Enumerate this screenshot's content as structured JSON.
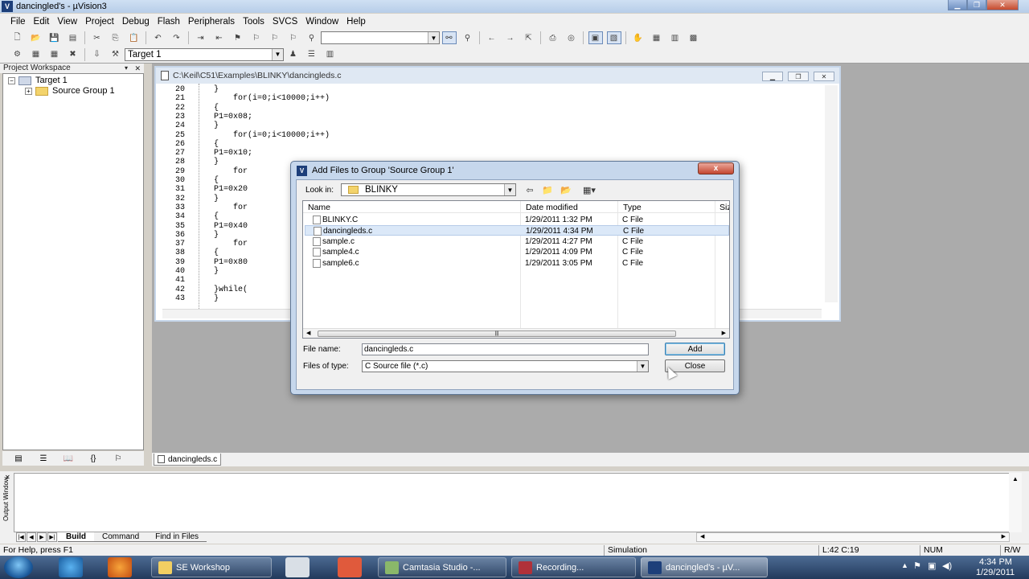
{
  "window": {
    "title": "dancingled's - µVision3"
  },
  "menu": [
    "File",
    "Edit",
    "View",
    "Project",
    "Debug",
    "Flash",
    "Peripherals",
    "Tools",
    "SVCS",
    "Window",
    "Help"
  ],
  "toolbar2": {
    "target_select": "Target 1"
  },
  "workspace": {
    "header": "Project Workspace",
    "tree": {
      "target": "Target 1",
      "group": "Source Group 1"
    }
  },
  "editor": {
    "path": "C:\\Keil\\C51\\Examples\\BLINKY\\dancingleds.c",
    "tab": "dancingleds.c",
    "lines": [
      {
        "n": "20",
        "t": "}"
      },
      {
        "n": "21",
        "t": "    for(i=0;i<10000;i++)"
      },
      {
        "n": "22",
        "t": "{"
      },
      {
        "n": "23",
        "t": "P1=0x08;"
      },
      {
        "n": "24",
        "t": "}"
      },
      {
        "n": "25",
        "t": "    for(i=0;i<10000;i++)"
      },
      {
        "n": "26",
        "t": "{"
      },
      {
        "n": "27",
        "t": "P1=0x10;"
      },
      {
        "n": "28",
        "t": "}"
      },
      {
        "n": "29",
        "t": "    for"
      },
      {
        "n": "30",
        "t": "{"
      },
      {
        "n": "31",
        "t": "P1=0x20"
      },
      {
        "n": "32",
        "t": "}"
      },
      {
        "n": "33",
        "t": "    for"
      },
      {
        "n": "34",
        "t": "{"
      },
      {
        "n": "35",
        "t": "P1=0x40"
      },
      {
        "n": "36",
        "t": "}"
      },
      {
        "n": "37",
        "t": "    for"
      },
      {
        "n": "38",
        "t": "{"
      },
      {
        "n": "39",
        "t": "P1=0x80"
      },
      {
        "n": "40",
        "t": "}"
      },
      {
        "n": "41",
        "t": ""
      },
      {
        "n": "42",
        "t": "}while("
      },
      {
        "n": "43",
        "t": "}"
      }
    ]
  },
  "dialog": {
    "title": "Add Files to Group 'Source Group 1'",
    "close_glyph": "x",
    "look_in_label": "Look in:",
    "look_in_value": "BLINKY",
    "columns": {
      "name": "Name",
      "date": "Date modified",
      "type": "Type",
      "size": "Siz"
    },
    "files": [
      {
        "name": "BLINKY.C",
        "date": "1/29/2011 1:32 PM",
        "type": "C File"
      },
      {
        "name": "dancingleds.c",
        "date": "1/29/2011 4:34 PM",
        "type": "C File"
      },
      {
        "name": "sample.c",
        "date": "1/29/2011 4:27 PM",
        "type": "C File"
      },
      {
        "name": "sample4.c",
        "date": "1/29/2011 4:09 PM",
        "type": "C File"
      },
      {
        "name": "sample6.c",
        "date": "1/29/2011 3:05 PM",
        "type": "C File"
      }
    ],
    "file_name_label": "File name:",
    "file_name_value": "dancingleds.c",
    "file_type_label": "Files of type:",
    "file_type_value": "C Source file (*.c)",
    "add_button": "Add",
    "close_button": "Close"
  },
  "output": {
    "side_label": "Output Window",
    "tabs": [
      "Build",
      "Command",
      "Find in Files"
    ]
  },
  "status": {
    "help": "For Help, press F1",
    "mode": "Simulation",
    "position": "L:42 C:19",
    "num": "NUM",
    "rw": "R/W"
  },
  "taskbar": {
    "tasks": [
      "SE Workshop",
      "Camtasia Studio -...",
      "Recording...",
      "dancingled's - µV..."
    ],
    "time": "4:34 PM",
    "date": "1/29/2011"
  }
}
